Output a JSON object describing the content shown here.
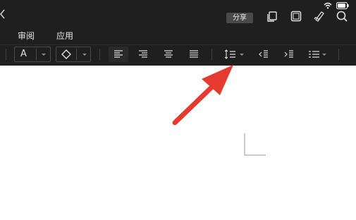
{
  "header": {
    "share_label": "分享",
    "top_icons": [
      "copy-icon",
      "frame-icon",
      "pen-icon",
      "search-icon"
    ]
  },
  "menu": {
    "tabs": [
      {
        "label": "审阅"
      },
      {
        "label": "应用"
      }
    ]
  },
  "toolbar": {
    "font_color_label": "A",
    "tools": [
      "font-color-dropdown",
      "fill-color-dropdown",
      "align-left",
      "align-right",
      "align-center",
      "justify",
      "line-spacing-dropdown",
      "decrease-indent",
      "increase-indent",
      "list-style-dropdown"
    ]
  },
  "colors": {
    "toolbar_bg": "#1f1f1f",
    "arrow": "#e53a30"
  }
}
